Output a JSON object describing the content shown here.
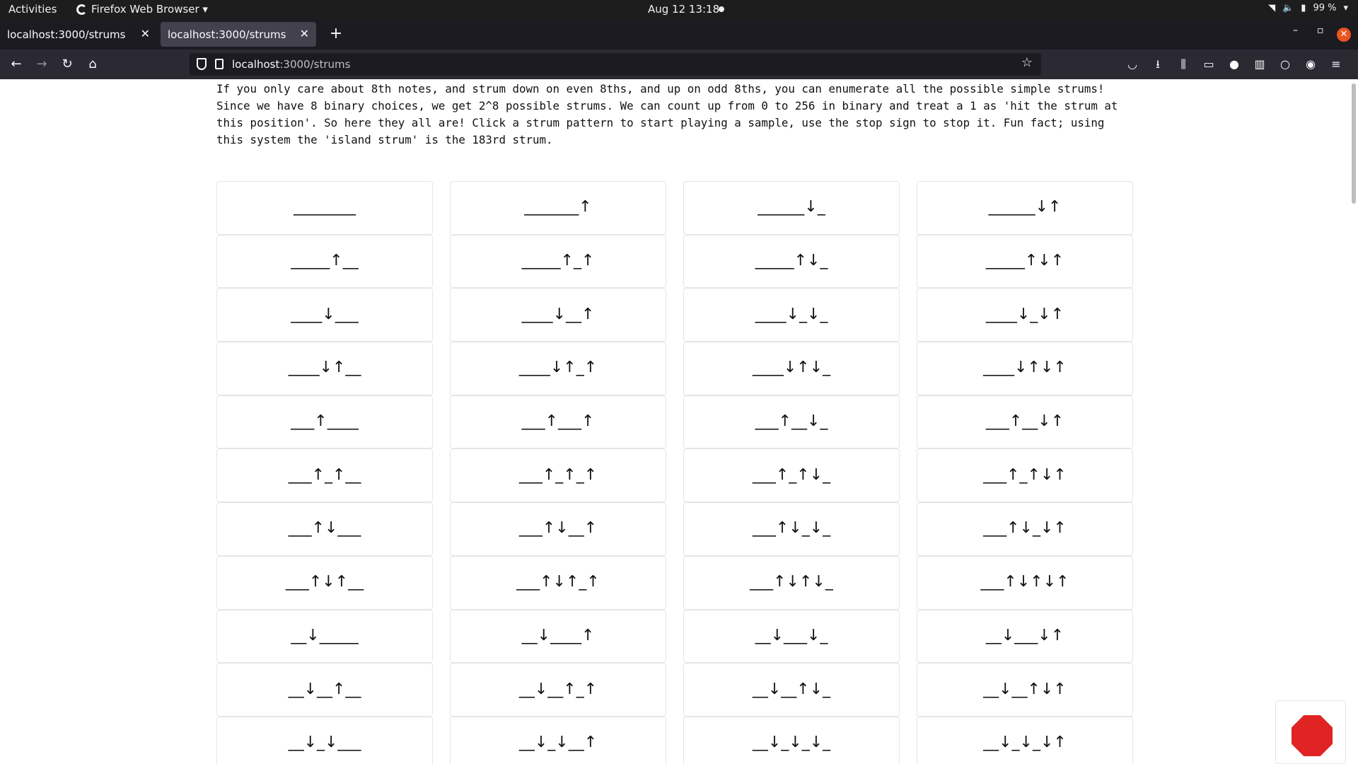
{
  "system_bar": {
    "activities": "Activities",
    "app_name": "Firefox Web Browser ▾",
    "clock": "Aug 12  13:18",
    "battery": "99 %"
  },
  "browser": {
    "tabs": [
      {
        "title": "localhost:3000/strums"
      },
      {
        "title": "localhost:3000/strums"
      }
    ],
    "url_host": "localhost",
    "url_path": ":3000/strums"
  },
  "page": {
    "intro": "If you only care about 8th notes, and strum down on even 8ths, and up on odd 8ths, you can enumerate all the possible simple strums!\nSince we have 8 binary choices, we get 2^8 possible strums. We can count up from 0 to 256 in binary and treat a 1 as 'hit the strum at\nthis position'. So here they all are! Click a strum pattern to start playing a sample, use the stop sign to stop it. Fun fact; using\nthis system the 'island strum' is the 183rd strum.",
    "strums": [
      "________",
      "_______↑",
      "______↓_",
      "______↓↑",
      "_____↑__",
      "_____↑_↑",
      "_____↑↓_",
      "_____↑↓↑",
      "____↓___",
      "____↓__↑",
      "____↓_↓_",
      "____↓_↓↑",
      "____↓↑__",
      "____↓↑_↑",
      "____↓↑↓_",
      "____↓↑↓↑",
      "___↑____",
      "___↑___↑",
      "___↑__↓_",
      "___↑__↓↑",
      "___↑_↑__",
      "___↑_↑_↑",
      "___↑_↑↓_",
      "___↑_↑↓↑",
      "___↑↓___",
      "___↑↓__↑",
      "___↑↓_↓_",
      "___↑↓_↓↑",
      "___↑↓↑__",
      "___↑↓↑_↑",
      "___↑↓↑↓_",
      "___↑↓↑↓↑",
      "__↓_____",
      "__↓____↑",
      "__↓___↓_",
      "__↓___↓↑",
      "__↓__↑__",
      "__↓__↑_↑",
      "__↓__↑↓_",
      "__↓__↑↓↑",
      "__↓_↓___",
      "__↓_↓__↑",
      "__↓_↓_↓_",
      "__↓_↓_↓↑"
    ]
  }
}
